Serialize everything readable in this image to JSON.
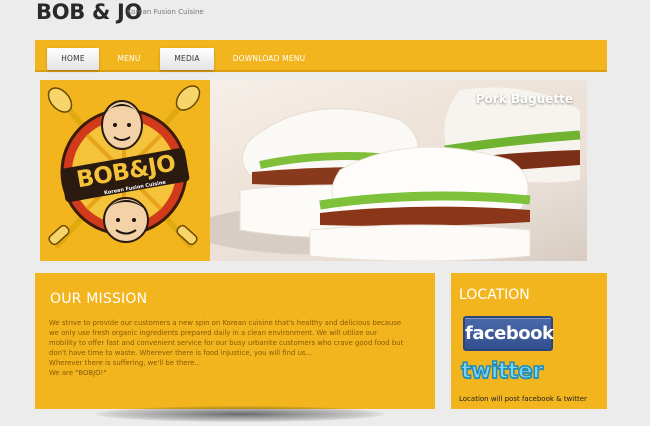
{
  "header": {
    "title": "BOB & JO",
    "tagline": "Korean Fusion Cuisine"
  },
  "nav": {
    "items": [
      {
        "label": "HOME",
        "active": true
      },
      {
        "label": "MENU",
        "active": false
      },
      {
        "label": "MEDIA",
        "active": true
      },
      {
        "label": "DOWNLOAD MENU",
        "active": false
      }
    ]
  },
  "banner": {
    "logo_text": "BOB&JO",
    "logo_subtitle": "Korean Fusion Cuisine",
    "caption": "Pork Baguette"
  },
  "mission": {
    "title": "OUR MISSION",
    "lines": [
      "We strive to provide our customers a new spin on Korean cuisine that's healthy and delicious because",
      "we only use fresh organic ingredients prepared daily in a clean environment. We will utilize our",
      "mobility to offer fast and convenient service for our busy urbanite customers who crave good food but",
      "don't have time to waste. Wherever there is food injustice, you will find us...",
      "Wherever there is suffering, we'll be there...",
      "We are \"BOBJO!\""
    ]
  },
  "location": {
    "title": "LOCATION",
    "facebook_label": "facebook",
    "twitter_label": "twitter",
    "note": "Location will post facebook & twitter"
  },
  "colors": {
    "accent": "#f2b51e",
    "background": "#ececec",
    "mission_text": "#8a5a06"
  }
}
